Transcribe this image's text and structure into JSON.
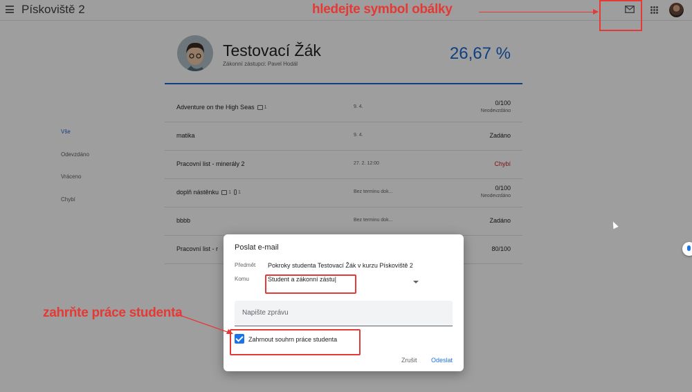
{
  "header": {
    "class_title": "Pískoviště 2"
  },
  "student": {
    "name": "Testovací Žák",
    "guardians": "Zákonní zástupci: Pavel Hodál",
    "grade_percent": "26,67 %"
  },
  "filters": [
    "Vše",
    "Odevzdáno",
    "Vráceno",
    "Chybí"
  ],
  "assignments": [
    {
      "title": "Adventure on the High Seas",
      "comments": "1",
      "attachments": "",
      "date": "9. 4.",
      "status": "0/100",
      "substatus": "Neodevzdáno"
    },
    {
      "title": "matika",
      "comments": "",
      "attachments": "",
      "date": "9. 4.",
      "status": "Zadáno",
      "substatus": ""
    },
    {
      "title": "Pracovní list - minerály 2",
      "comments": "",
      "attachments": "",
      "date": "27. 2. 12:00",
      "status": "Chybí",
      "substatus": ""
    },
    {
      "title": "doplň nástěnku",
      "comments": "1",
      "attachments": "1",
      "date": "Bez terminu dok...",
      "status": "0/100",
      "substatus": "Neodevzdáno"
    },
    {
      "title": "bbbb",
      "comments": "",
      "attachments": "",
      "date": "Bez terminu dok...",
      "status": "Zadáno",
      "substatus": ""
    },
    {
      "title": "Pracovní list - r",
      "comments": "",
      "attachments": "",
      "date": "",
      "status": "80/100",
      "substatus": ""
    }
  ],
  "dialog": {
    "title": "Poslat e-mail",
    "subject_label": "Předmět",
    "subject": "Pokroky studenta Testovací Žák v kurzu Pískoviště 2",
    "to_label": "Komu",
    "to_value": "Student a zákonní zástu|",
    "message_placeholder": "Napište zprávu",
    "include_label": "Zahrnout souhrn práce studenta",
    "cancel": "Zrušit",
    "send": "Odeslat"
  },
  "annotations": {
    "top": "hledejte symbol obálky",
    "left": "zahrňte práce studenta",
    "color": "#e53935"
  },
  "colors": {
    "accent": "#1967d2",
    "missing": "#c5221f"
  }
}
